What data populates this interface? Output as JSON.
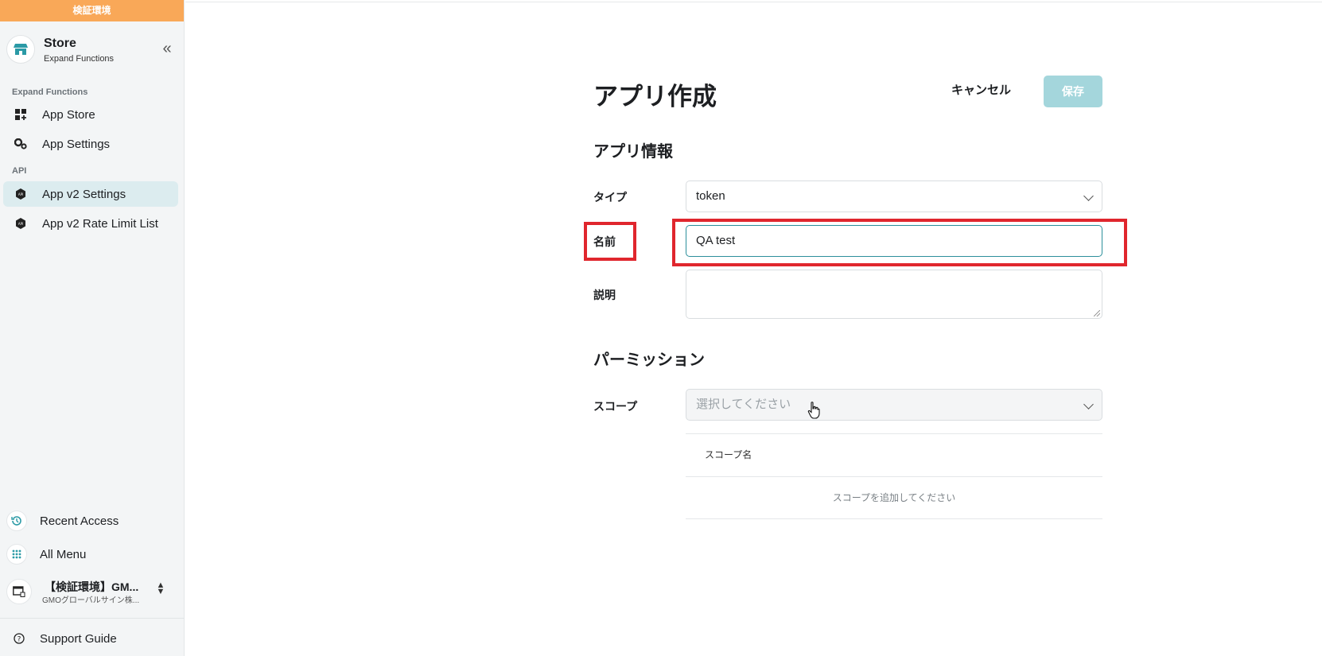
{
  "env_banner": "検証環境",
  "store": {
    "title": "Store",
    "subtitle": "Expand Functions"
  },
  "sidebar": {
    "section1": "Expand Functions",
    "items1": [
      {
        "label": "App Store",
        "icon": "grid-plus-icon"
      },
      {
        "label": "App Settings",
        "icon": "gears-icon"
      }
    ],
    "section2": "API",
    "items2": [
      {
        "label": "App v2 Settings",
        "icon": "api-icon",
        "active": true
      },
      {
        "label": "App v2 Rate Limit List",
        "icon": "api-icon"
      }
    ],
    "recent": "Recent Access",
    "all_menu": "All Menu",
    "org_name": "【検証環境】GM...",
    "org_sub": "GMOグローバルサイン株...",
    "support": "Support Guide"
  },
  "main": {
    "title": "アプリ作成",
    "cancel": "キャンセル",
    "save": "保存",
    "section_info": "アプリ情報",
    "type_label": "タイプ",
    "type_value": "token",
    "name_label": "名前",
    "name_value": "QA test",
    "desc_label": "説明",
    "section_perm": "パーミッション",
    "scope_label": "スコープ",
    "scope_placeholder": "選択してください",
    "table_header": "スコープ名",
    "table_empty": "スコープを追加してください"
  },
  "colors": {
    "accent": "#2c8f9b",
    "save_disabled": "#a4d6dc",
    "banner": "#f9a858",
    "highlight": "#e0262d"
  }
}
